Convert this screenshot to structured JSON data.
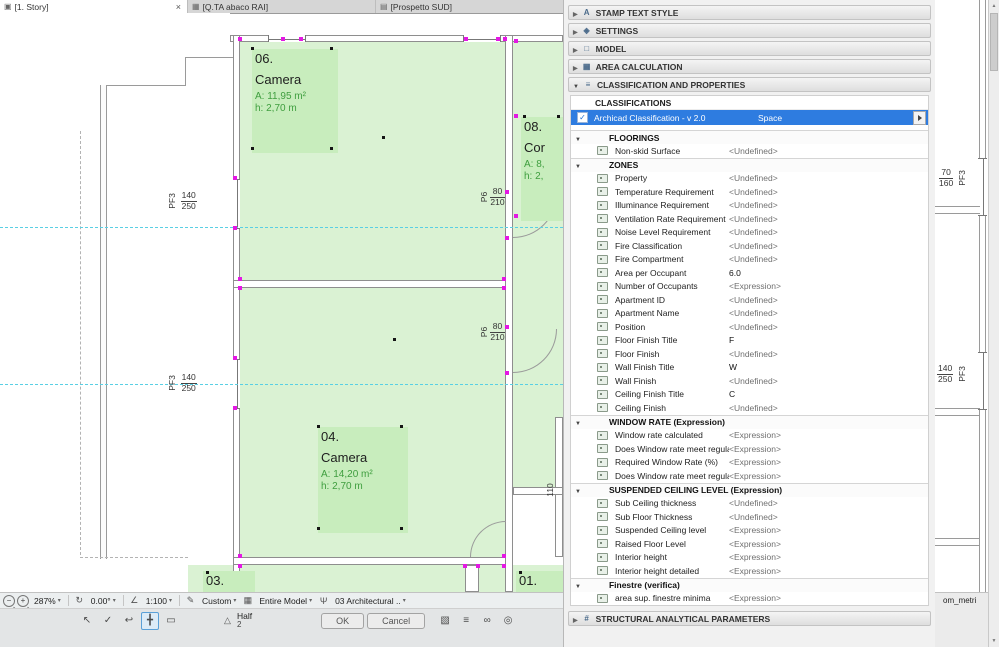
{
  "window": {
    "footer_right": "om_metri"
  },
  "tabs": [
    {
      "label": "[1. Story]"
    },
    {
      "label": "[Q.TA abaco RAI]"
    },
    {
      "label": "[Prospetto SUD]"
    }
  ],
  "icons": {
    "story": "▣",
    "schedule": "▦",
    "elevation": "▤",
    "close": "×",
    "minus": "−",
    "plus": "+",
    "rotate": "↻",
    "scale": "∠",
    "pen": "✎",
    "grid": "▦",
    "layers": "Ψ",
    "cursor": "↖",
    "check": "✓",
    "undo": "↩",
    "move": "╋",
    "pencil": "▭",
    "snap": "△",
    "cube": "▧",
    "stack": "≡",
    "link": "∞",
    "target": "◎",
    "sec_class": "≡",
    "sec_struct": "#",
    "tri_up": "▲",
    "tri_down": "▼"
  },
  "plan": {
    "rooms": [
      {
        "number": "06.",
        "name": "Camera",
        "area": "A: 11,95 m²",
        "height": "h: 2,70 m"
      },
      {
        "number": "08.",
        "name": "Cor",
        "area": "A: 8,",
        "height": "h: 2,"
      },
      {
        "number": "04.",
        "name": "Camera",
        "area": "A: 14,20 m²",
        "height": "h: 2,70 m"
      },
      {
        "number": "03.",
        "name": "",
        "area": "",
        "height": ""
      },
      {
        "number": "01.",
        "name": "",
        "area": "",
        "height": ""
      }
    ],
    "dims": {
      "left_upper": {
        "tag": "PF3",
        "top": "140",
        "bottom": "250"
      },
      "left_lower": {
        "tag": "PF3",
        "top": "140",
        "bottom": "250"
      },
      "door_upper": {
        "tag": "P6",
        "top": "80",
        "bottom": "210"
      },
      "door_lower": {
        "tag": "P6",
        "top": "80",
        "bottom": "210"
      },
      "strip_upper": {
        "tag": "PF3",
        "top": "70",
        "bottom": "160"
      },
      "strip_lower": {
        "tag": "PF3",
        "top": "140",
        "bottom": "250"
      },
      "small": "110"
    }
  },
  "panel": {
    "top_sections": [
      {
        "label": "STAMP TEXT STYLE",
        "icon": "A"
      },
      {
        "label": "SETTINGS",
        "icon": "◈"
      },
      {
        "label": "MODEL",
        "icon": "□"
      },
      {
        "label": "AREA CALCULATION",
        "icon": "▦"
      }
    ],
    "expanded_section": "CLASSIFICATION AND PROPERTIES",
    "classifications_header": "CLASSIFICATIONS",
    "classification": {
      "name": "Archicad Classification - v 2.0",
      "value": "Space"
    },
    "groups": [
      {
        "title": "FLOORINGS",
        "rows": [
          {
            "name": "Non-skid Surface",
            "value": "<Undefined>"
          }
        ]
      },
      {
        "title": "ZONES",
        "rows": [
          {
            "name": "Property",
            "value": "<Undefined>"
          },
          {
            "name": "Temperature Requirement",
            "value": "<Undefined>"
          },
          {
            "name": "Illuminance Requirement",
            "value": "<Undefined>"
          },
          {
            "name": "Ventilation Rate Requirement",
            "value": "<Undefined>"
          },
          {
            "name": "Noise Level Requirement",
            "value": "<Undefined>"
          },
          {
            "name": "Fire Classification",
            "value": "<Undefined>"
          },
          {
            "name": "Fire Compartment",
            "value": "<Undefined>"
          },
          {
            "name": "Area per Occupant",
            "value": "6.0"
          },
          {
            "name": "Number of Occupants",
            "value": "<Expression>"
          },
          {
            "name": "Apartment ID",
            "value": "<Undefined>"
          },
          {
            "name": "Apartment Name",
            "value": "<Undefined>"
          },
          {
            "name": "Position",
            "value": "<Undefined>"
          },
          {
            "name": "Floor Finish Title",
            "value": "F"
          },
          {
            "name": "Floor Finish",
            "value": "<Undefined>"
          },
          {
            "name": "Wall Finish Title",
            "value": "W"
          },
          {
            "name": "Wall Finish",
            "value": "<Undefined>"
          },
          {
            "name": "Ceiling Finish Title",
            "value": "C"
          },
          {
            "name": "Ceiling Finish",
            "value": "<Undefined>"
          }
        ]
      },
      {
        "title": "WINDOW RATE (Expression)",
        "rows": [
          {
            "name": "Window rate calculated",
            "value": "<Expression>"
          },
          {
            "name": "Does Window rate meet regulat...",
            "value": "<Expression>"
          },
          {
            "name": "Required Window Rate (%)",
            "value": "<Expression>"
          },
          {
            "name": "Does Window rate meet regulat...",
            "value": "<Expression>"
          }
        ]
      },
      {
        "title": "SUSPENDED CEILING LEVEL (Expression)",
        "rows": [
          {
            "name": "Sub Ceiling thickness",
            "value": "<Undefined>"
          },
          {
            "name": "Sub Floor Thickness",
            "value": "<Undefined>"
          },
          {
            "name": "Suspended Ceiling level",
            "value": "<Expression>"
          },
          {
            "name": "Raised Floor Level",
            "value": "<Expression>"
          },
          {
            "name": "Interior height",
            "value": "<Expression>"
          },
          {
            "name": "Interior height detailed",
            "value": "<Expression>"
          }
        ]
      },
      {
        "title": "Finestre (verifica)",
        "rows": [
          {
            "name": "area sup. finestre minima",
            "value": "<Expression>"
          }
        ]
      }
    ],
    "bottom_section": "STRUCTURAL ANALYTICAL PARAMETERS"
  },
  "statusbar": {
    "zoom": "287%",
    "rotation": "0.00°",
    "scale": "1:100",
    "pen_set": "Custom",
    "model_filter": "Entire Model",
    "layer_combination": "03 Architectural ..",
    "snap": "Half",
    "snap_divisions": "2",
    "ok": "OK",
    "cancel": "Cancel"
  }
}
